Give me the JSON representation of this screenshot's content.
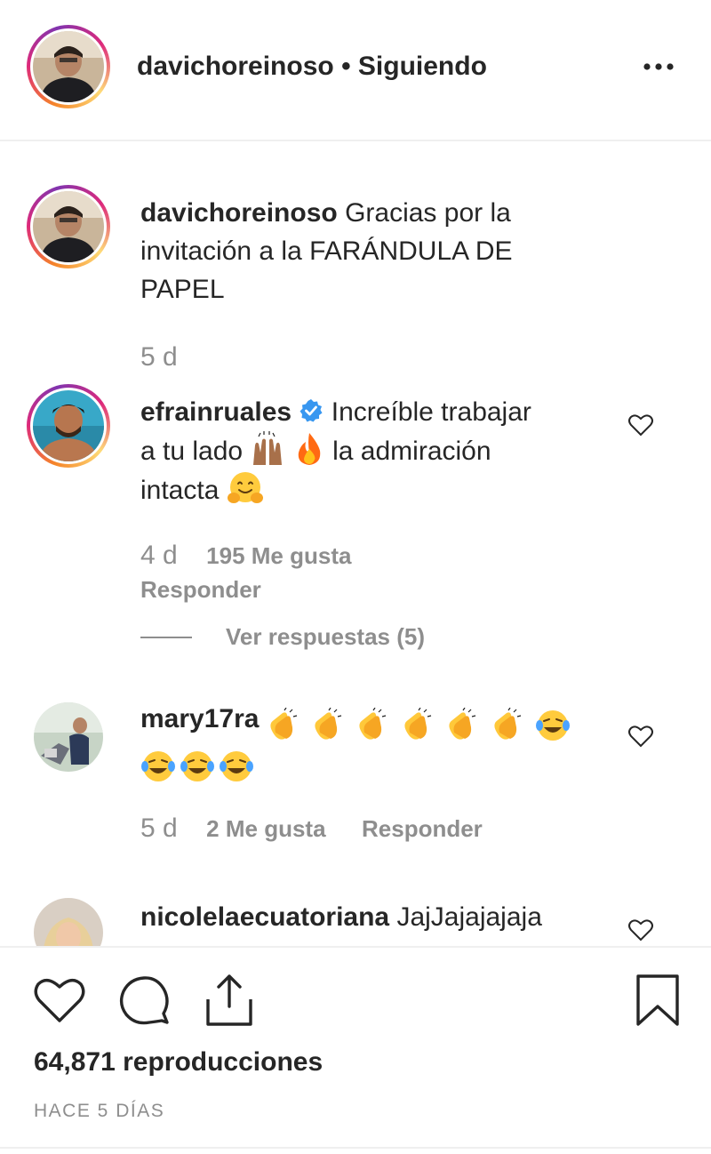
{
  "header": {
    "username": "davichoreinoso",
    "separator": "•",
    "follow_status": "Siguiendo",
    "more_label": "•••"
  },
  "caption": {
    "username": "davichoreinoso",
    "text_line1": "Gracias por la",
    "text_line2": "invitación a la FARÁNDULA DE",
    "text_line3": "PAPEL",
    "time": "5 d"
  },
  "comments": [
    {
      "username": "efrainruales",
      "text_line1": "Increíble trabajar",
      "text_line2a": "a tu lado",
      "text_line2b": "la admiración",
      "text_line3": "intacta",
      "time": "4 d",
      "likes": "195 Me gusta",
      "reply": "Responder",
      "view_replies": "Ver respuestas (5)"
    },
    {
      "username": "mary17ra",
      "time": "5 d",
      "likes": "2 Me gusta",
      "reply": "Responder"
    },
    {
      "username": "nicolelaecuatoriana",
      "text": "JajJajajajaja"
    }
  ],
  "footer": {
    "views": "64,871 reproducciones",
    "date": "HACE 5 DÍAS"
  },
  "colors": {
    "text": "#262626",
    "muted": "#8e8e8e",
    "verified": "#3897f0",
    "divider": "#efefef"
  }
}
